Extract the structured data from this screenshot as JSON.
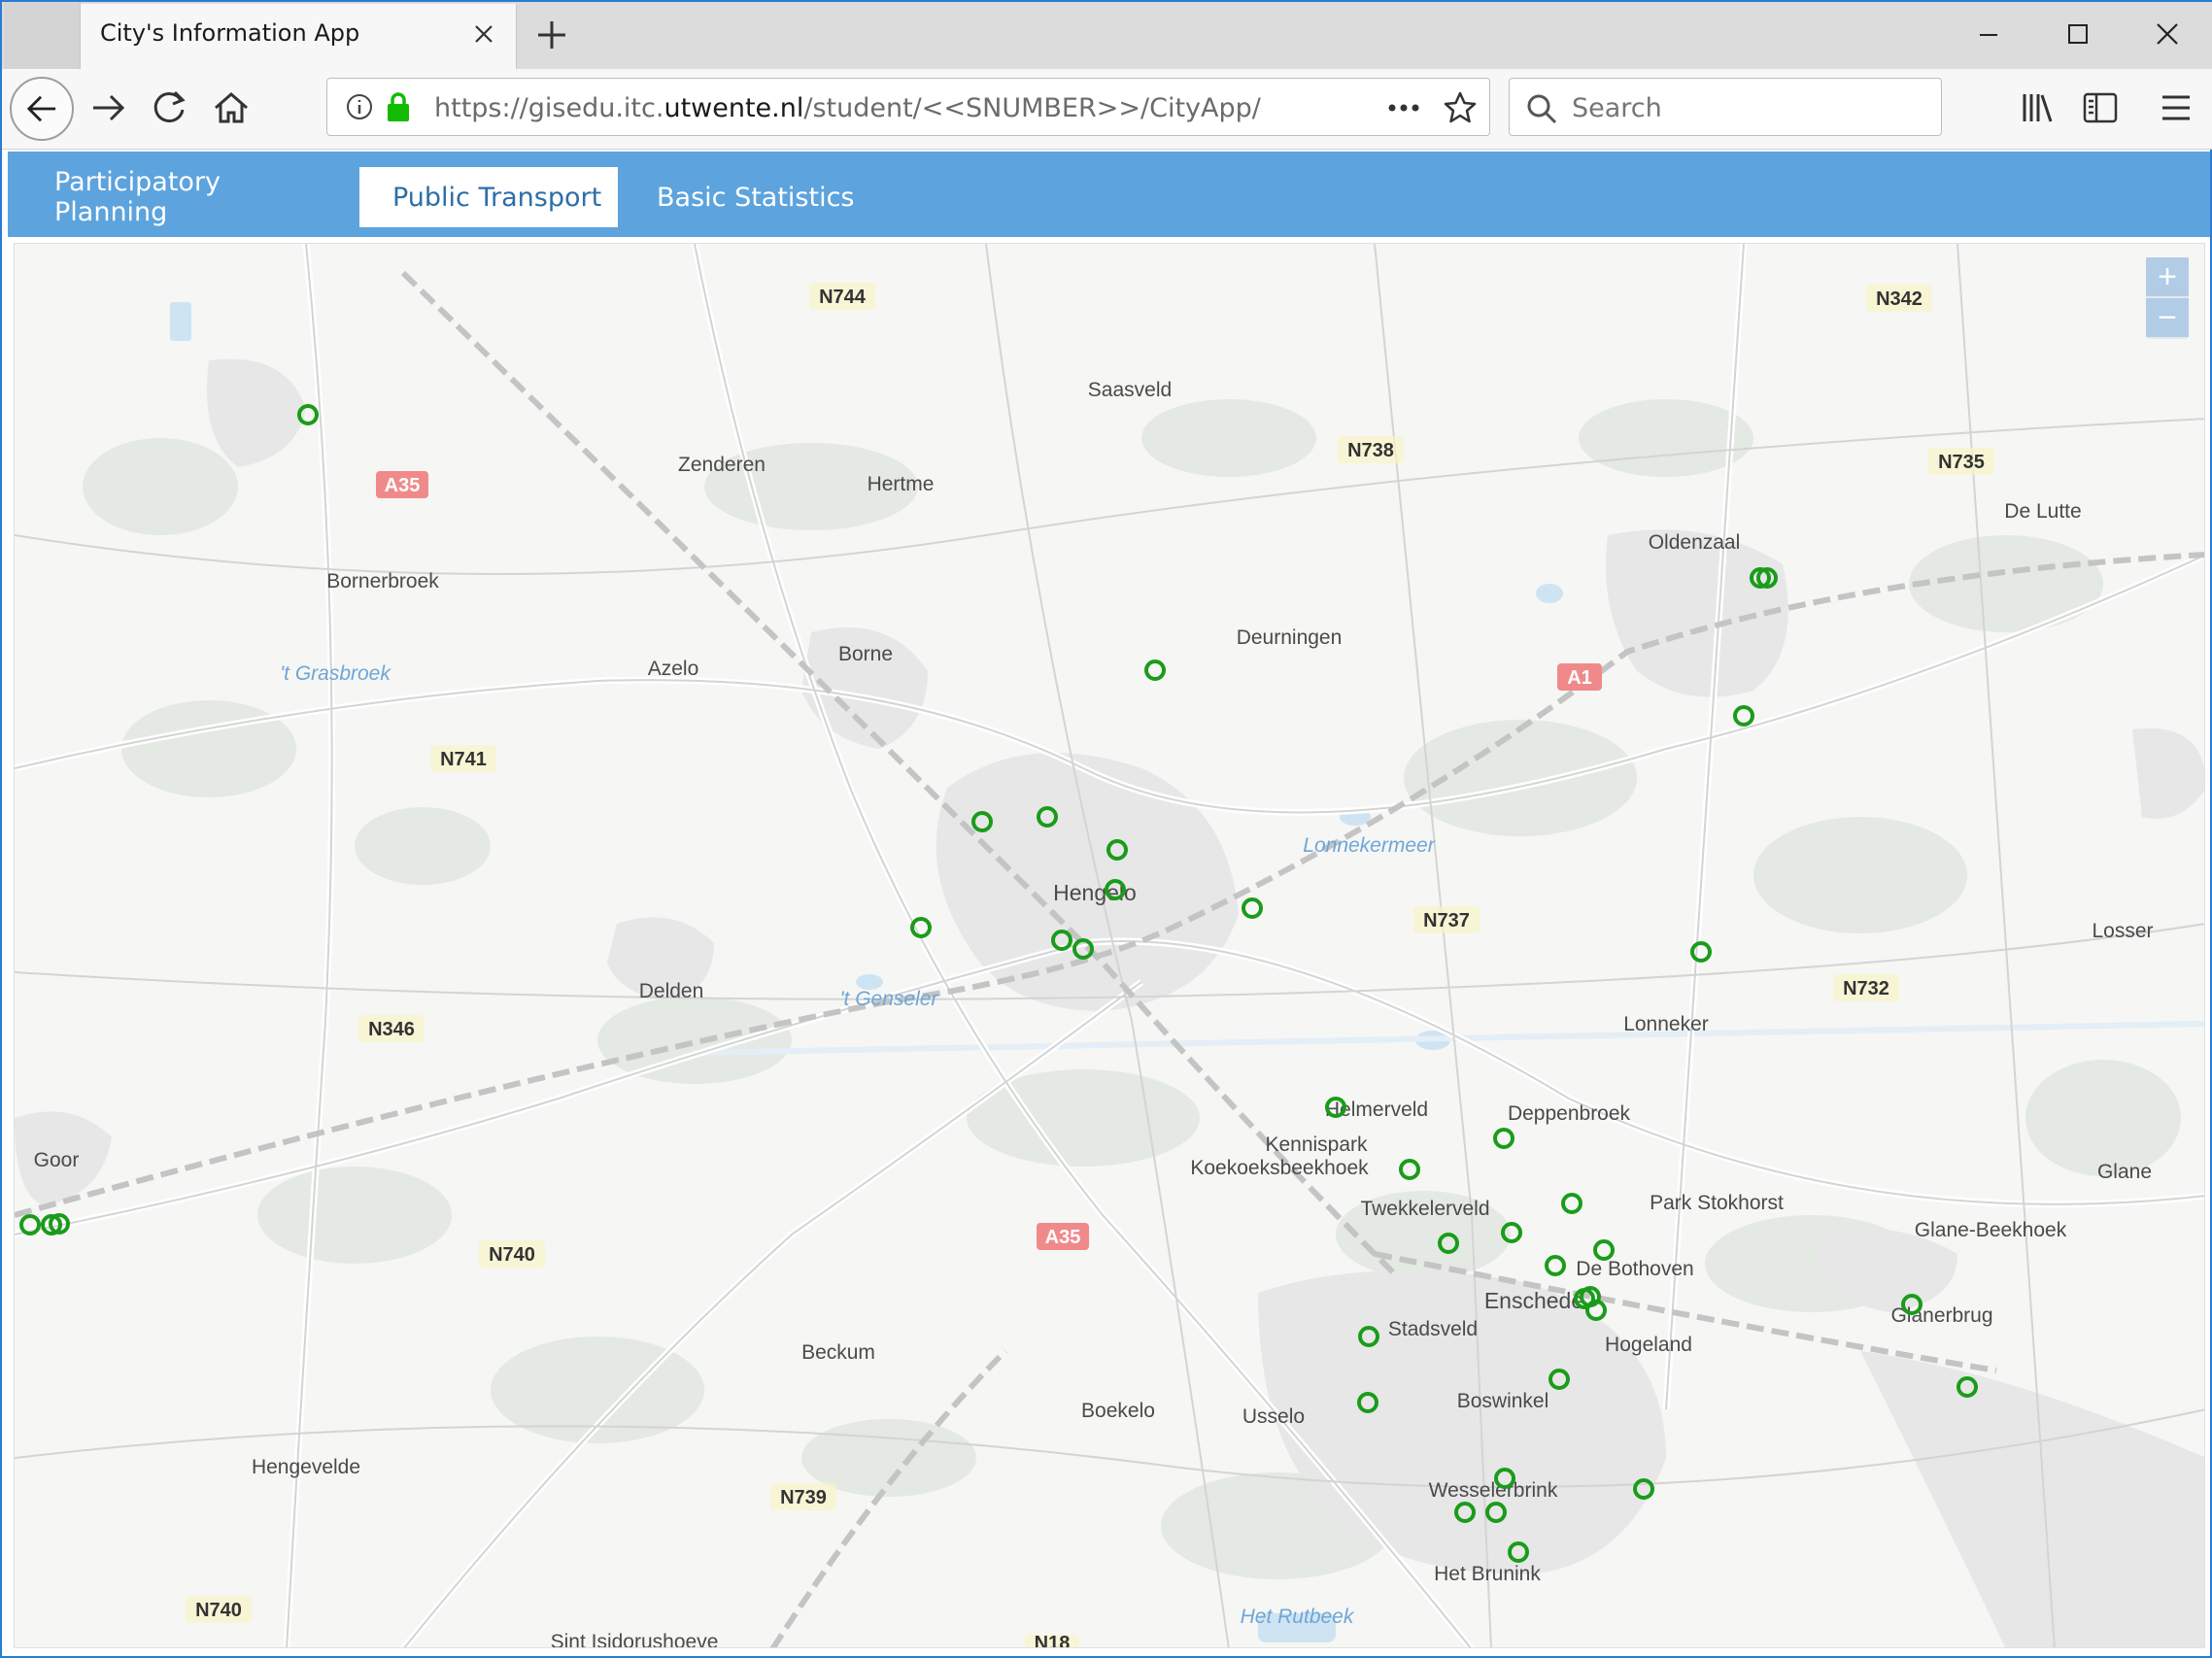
{
  "browser": {
    "tab_title": "City's Information App",
    "url_prefix": "https://gisedu.itc.",
    "url_domain": "utwente.nl",
    "url_path": "/student/<<SNUMBER>>/CityApp/",
    "search_placeholder": "Search"
  },
  "app": {
    "tabs": [
      {
        "label": "Participatory Planning",
        "active": false
      },
      {
        "label": "Public Transport",
        "active": true
      },
      {
        "label": "Basic Statistics",
        "active": false
      }
    ]
  },
  "map": {
    "zoom_in": "+",
    "zoom_out": "−",
    "marker_color": "#1a9c1a",
    "road_labels": [
      "N744",
      "N342",
      "N738",
      "N735",
      "A35",
      "A1",
      "N741",
      "N737",
      "N732",
      "N346",
      "A35",
      "N740",
      "N739",
      "N740",
      "N18"
    ],
    "place_labels": [
      "Saasveld",
      "Zenderen",
      "Hertme",
      "Oldenzaal",
      "De Lutte",
      "Bornerbroek",
      "Deurningen",
      "Azelo",
      "Borne",
      "Hengelo",
      "Losser",
      "Delden",
      "Lonneker",
      "Goor",
      "Glane",
      "Glane-Beekhoek",
      "Deppenbroek",
      "Kennispark",
      "Koekoeksbeekhoek",
      "Twekkelerveld",
      "Park Stokhorst",
      "De Bothoven",
      "Enschede",
      "Glanerbrug",
      "Stadsveld",
      "Hogeland",
      "Beckum",
      "Boswinkel",
      "Boekelo",
      "Usselo",
      "Hengevelde",
      "Wesselerbrink",
      "Het Brunink",
      "Sint Isidorushoeve",
      "Helmerveld"
    ],
    "water_labels": [
      "'t Grasbroek",
      "Lonnekermeer",
      "'t Genseler",
      "Het Rutbeek"
    ]
  }
}
